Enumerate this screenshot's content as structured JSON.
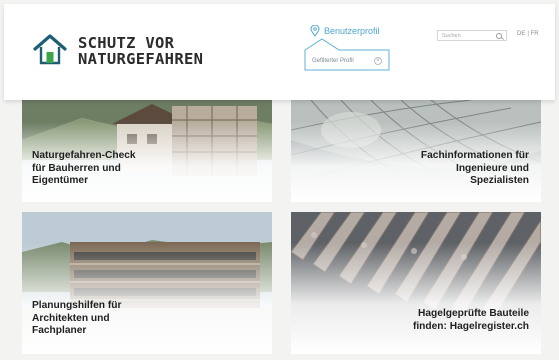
{
  "brand": {
    "line1": "SCHUTZ VOR",
    "line2": "NATURGEFAHREN",
    "colors": {
      "roof": "#1d5e74",
      "door": "#3aa64a",
      "text": "#2b2b2b"
    }
  },
  "header": {
    "profile_label": "Benutzerprofil",
    "profile_field": "Gefilterter Profil",
    "search_placeholder": "Suchen",
    "languages": [
      "DE",
      "FR"
    ],
    "accent": "#4fa6d0"
  },
  "tiles": [
    {
      "title": [
        "Naturgefahren-Check",
        "für Bauherren und",
        "Eigentümer"
      ]
    },
    {
      "title": [
        "Fachinformationen für",
        "Ingenieure und",
        "Spezialisten"
      ]
    },
    {
      "title": [
        "Planungshilfen für",
        "Architekten und",
        "Fachplaner"
      ]
    },
    {
      "title": [
        "Hagelgeprüfte Bauteile",
        "finden: Hagelregister.ch"
      ]
    }
  ]
}
